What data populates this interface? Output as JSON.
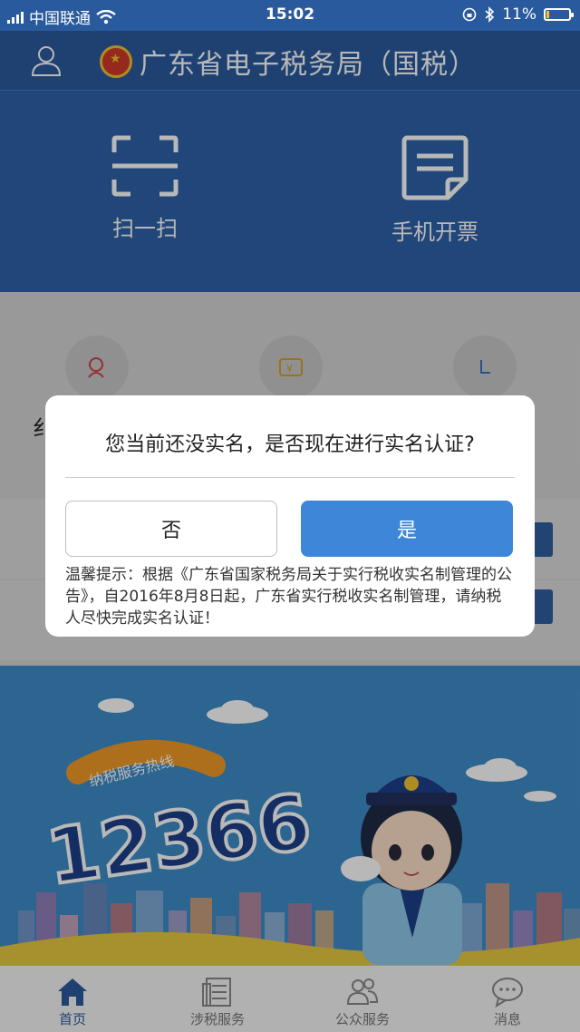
{
  "status_bar": {
    "carrier": "中国联通",
    "time": "15:02",
    "battery": "11%",
    "battery_level": 0.11
  },
  "header": {
    "title": "广东省电子税务局（国税）"
  },
  "banner": {
    "scan_label": "扫一扫",
    "invoice_label": "手机开票"
  },
  "background": {
    "partial_label": "纟"
  },
  "hotline": {
    "title": "纳税服务热线",
    "number": "12366"
  },
  "dialog": {
    "question": "您当前还没实名，是否现在进行实名认证?",
    "no_label": "否",
    "yes_label": "是",
    "tip": "温馨提示：根据《广东省国家税务局关于实行税收实名制管理的公告》，自2016年8月8日起，广东省实行税收实名制管理，请纳税人尽快完成实名认证！"
  },
  "tabbar": {
    "tabs": [
      {
        "label": "首页",
        "icon": "home-icon",
        "active": true
      },
      {
        "label": "涉税服务",
        "icon": "document-icon",
        "active": false
      },
      {
        "label": "公众服务",
        "icon": "people-icon",
        "active": false
      },
      {
        "label": "消息",
        "icon": "chat-icon",
        "active": false
      }
    ]
  },
  "colors": {
    "primary": "#2a5a9e",
    "button_blue": "#3e86d8",
    "sky": "#3f8dc9"
  }
}
